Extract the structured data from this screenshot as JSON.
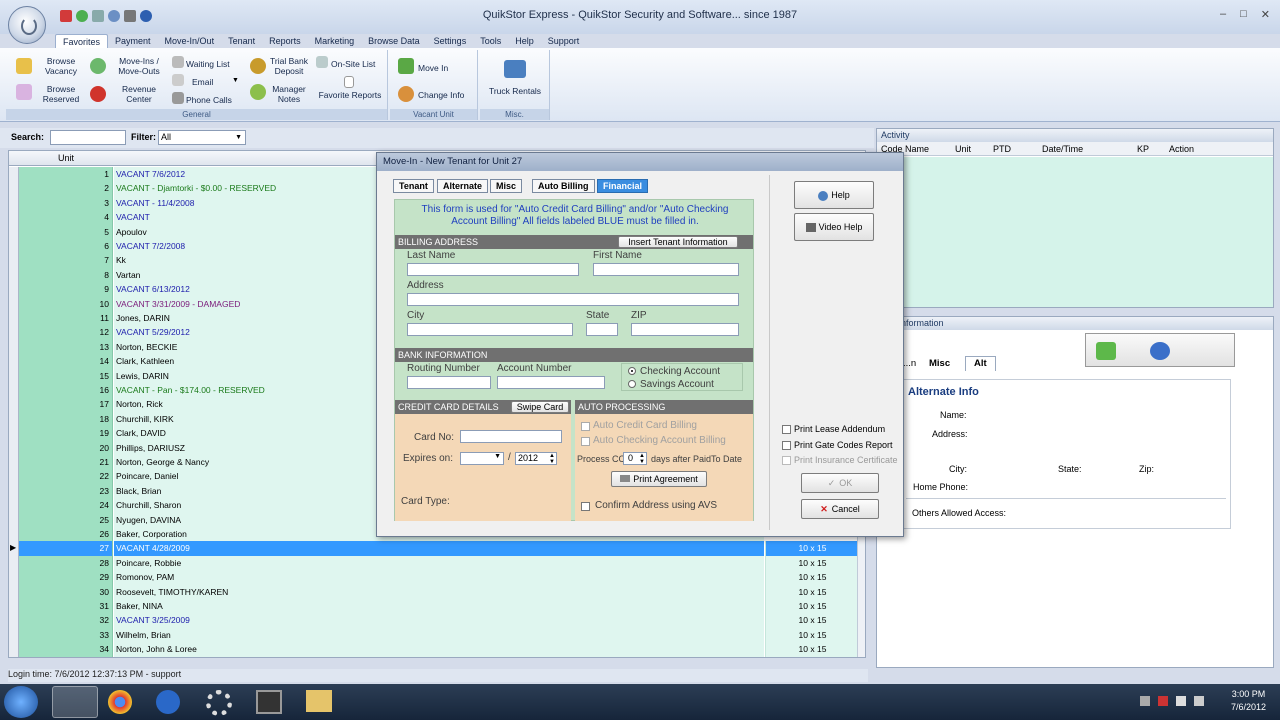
{
  "window": {
    "title": "QuikStor Express -    QuikStor Security and Software... since 1987"
  },
  "menu": [
    "Favorites",
    "Payment",
    "Move-In/Out",
    "Tenant",
    "Reports",
    "Marketing",
    "Browse Data",
    "Settings",
    "Tools",
    "Help",
    "Support"
  ],
  "ribbon": {
    "general": {
      "label": "General",
      "browse_vacancy": "Browse Vacancy",
      "browse_reserved": "Browse Reserved",
      "move_ins_outs": "Move-Ins / Move-Outs",
      "revenue_center": "Revenue Center",
      "waiting_list": "Waiting List",
      "email": "Email",
      "phone_calls": "Phone Calls",
      "trial_bank_deposit": "Trial Bank Deposit",
      "manager_notes": "Manager Notes",
      "on_site_list": "On-Site List",
      "favorite_reports": "Favorite Reports"
    },
    "vacant_unit": {
      "label": "Vacant Unit",
      "move_in": "Move In",
      "change_info": "Change Info"
    },
    "misc": {
      "label": "Misc.",
      "truck_rentals": "Truck Rentals"
    }
  },
  "search": {
    "label": "Search:",
    "filter_label": "Filter:",
    "filter_value": "All"
  },
  "grid": {
    "unit_header": "Unit",
    "rows": [
      {
        "num": "1",
        "name": "VACANT 7/6/2012",
        "size": "",
        "cls": "vacant"
      },
      {
        "num": "2",
        "name": "VACANT - Djamtorki - $0.00 - RESERVED",
        "size": "",
        "cls": "reserved"
      },
      {
        "num": "3",
        "name": "VACANT - 11/4/2008",
        "size": "",
        "cls": "vacant"
      },
      {
        "num": "4",
        "name": "VACANT",
        "size": "",
        "cls": "vacant"
      },
      {
        "num": "5",
        "name": "Apoulov",
        "size": "",
        "cls": ""
      },
      {
        "num": "6",
        "name": "VACANT 7/2/2008",
        "size": "",
        "cls": "vacant"
      },
      {
        "num": "7",
        "name": "Kk",
        "size": "",
        "cls": ""
      },
      {
        "num": "8",
        "name": "Vartan",
        "size": "",
        "cls": ""
      },
      {
        "num": "9",
        "name": "VACANT 6/13/2012",
        "size": "",
        "cls": "vacant"
      },
      {
        "num": "10",
        "name": "VACANT 3/31/2009 - DAMAGED",
        "size": "",
        "cls": "damaged"
      },
      {
        "num": "11",
        "name": "Jones, DARIN",
        "size": "",
        "cls": ""
      },
      {
        "num": "12",
        "name": "VACANT 5/29/2012",
        "size": "",
        "cls": "vacant"
      },
      {
        "num": "13",
        "name": "Norton, BECKIE",
        "size": "",
        "cls": ""
      },
      {
        "num": "14",
        "name": "Clark, Kathleen",
        "size": "",
        "cls": ""
      },
      {
        "num": "15",
        "name": "Lewis, DARIN",
        "size": "",
        "cls": ""
      },
      {
        "num": "16",
        "name": "VACANT - Pan - $174.00 - RESERVED",
        "size": "",
        "cls": "reserved"
      },
      {
        "num": "17",
        "name": "Norton, Rick",
        "size": "",
        "cls": ""
      },
      {
        "num": "18",
        "name": "Churchill, KIRK",
        "size": "",
        "cls": ""
      },
      {
        "num": "19",
        "name": "Clark, DAVID",
        "size": "",
        "cls": ""
      },
      {
        "num": "20",
        "name": "Phillips, DARIUSZ",
        "size": "",
        "cls": ""
      },
      {
        "num": "21",
        "name": "Norton, George & Nancy",
        "size": "",
        "cls": ""
      },
      {
        "num": "22",
        "name": "Poincare, Daniel",
        "size": "",
        "cls": ""
      },
      {
        "num": "23",
        "name": "Black, Brian",
        "size": "",
        "cls": ""
      },
      {
        "num": "24",
        "name": "Churchill, Sharon",
        "size": "",
        "cls": ""
      },
      {
        "num": "25",
        "name": "Nyugen, DAVINA",
        "size": "",
        "cls": ""
      },
      {
        "num": "26",
        "name": "Baker, Corporation",
        "size": "",
        "cls": ""
      },
      {
        "num": "27",
        "name": "VACANT 4/28/2009",
        "size": "10 x 15",
        "cls": "selected"
      },
      {
        "num": "28",
        "name": "Poincare, Robbie",
        "size": "10 x 15",
        "cls": ""
      },
      {
        "num": "29",
        "name": "Romonov, PAM",
        "size": "10 x 15",
        "cls": ""
      },
      {
        "num": "30",
        "name": "Roosevelt, TIMOTHY/KAREN",
        "size": "10 x 15",
        "cls": ""
      },
      {
        "num": "31",
        "name": "Baker, NINA",
        "size": "10 x 15",
        "cls": ""
      },
      {
        "num": "32",
        "name": "VACANT 3/25/2009",
        "size": "10 x 15",
        "cls": "vacant"
      },
      {
        "num": "33",
        "name": "Wilhelm, Brian",
        "size": "10 x 15",
        "cls": ""
      },
      {
        "num": "34",
        "name": "Norton, John & Loree",
        "size": "10 x 15",
        "cls": ""
      }
    ]
  },
  "status": {
    "login": "Login time: 7/6/2012 12:37:13 PM - support"
  },
  "activity": {
    "title": "Activity",
    "columns": [
      "Code Name",
      "Unit",
      "PTD",
      "Date/Time",
      "KP",
      "Action"
    ]
  },
  "tenant_info": {
    "title": "...nt Information",
    "tabs": [
      "...n",
      "Misc",
      "Alt"
    ],
    "alt_header": "Alternate Info",
    "name": "Name:",
    "address": "Address:",
    "city": "City:",
    "state": "State:",
    "zip": "Zip:",
    "home_phone": "Home Phone:",
    "others": "Others Allowed Access:"
  },
  "dialog": {
    "title": "Move-In - New Tenant for Unit   27",
    "tabs": [
      "Tenant",
      "Alternate",
      "Misc",
      "Auto Billing",
      "Financial"
    ],
    "note": "This form is used for \"Auto Credit Card Billing\" and/or \"Auto Checking Account Billing\" All fields labeled BLUE must be filled in.",
    "billing_address": "BILLING ADDRESS",
    "insert_tenant": "Insert Tenant Information",
    "last_name": "Last Name",
    "first_name": "First Name",
    "address": "Address",
    "city": "City",
    "state": "State",
    "zip": "ZIP",
    "bank_info": "BANK INFORMATION",
    "routing": "Routing Number",
    "account": "Account Number",
    "checking": "Checking Account",
    "savings": "Savings Account",
    "cc_details": "CREDIT CARD DETAILS",
    "swipe": "Swipe Card",
    "card_no": "Card No:",
    "expires": "Expires on:",
    "slash": "/",
    "year": "2012",
    "card_type": "Card Type:",
    "auto_processing": "AUTO PROCESSING",
    "auto_cc": "Auto Credit Card Billing",
    "auto_check": "Auto Checking Account Billing",
    "process_cc": "Process CC",
    "process_days": "0",
    "days_after": "days after PaidTo Date",
    "print_agreement": "Print Agreement",
    "confirm_avs": "Confirm Address using AVS",
    "help": "Help",
    "video_help": "Video Help",
    "print_lease": "Print Lease Addendum",
    "print_gate": "Print Gate Codes Report",
    "print_insurance": "Print Insurance Certificate",
    "ok": "OK",
    "cancel": "Cancel"
  },
  "tray": {
    "time": "3:00 PM",
    "date": "7/6/2012"
  }
}
